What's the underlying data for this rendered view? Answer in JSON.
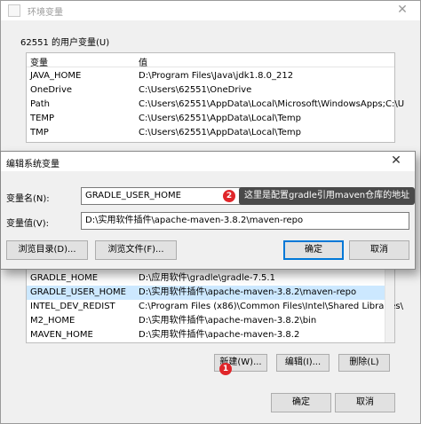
{
  "back_window": {
    "title": "环境变量",
    "close_glyph": "✕",
    "user_vars_label": "62551 的用户变量(U)",
    "user_vars": {
      "columns": [
        "变量",
        "值"
      ],
      "rows": [
        {
          "name": "JAVA_HOME",
          "value": "D:\\Program Files\\Java\\jdk1.8.0_212"
        },
        {
          "name": "OneDrive",
          "value": "C:\\Users\\62551\\OneDrive"
        },
        {
          "name": "Path",
          "value": "C:\\Users\\62551\\AppData\\Local\\Microsoft\\WindowsApps;C:\\U"
        },
        {
          "name": "TEMP",
          "value": "C:\\Users\\62551\\AppData\\Local\\Temp"
        },
        {
          "name": "TMP",
          "value": "C:\\Users\\62551\\AppData\\Local\\Temp"
        }
      ]
    },
    "system_vars": {
      "rows": [
        {
          "name": "GRADLE_HOME",
          "value": "D:\\应用软件\\gradle\\gradle-7.5.1"
        },
        {
          "name": "GRADLE_USER_HOME",
          "value": "D:\\实用软件插件\\apache-maven-3.8.2\\maven-repo"
        },
        {
          "name": "INTEL_DEV_REDIST",
          "value": "C:\\Program Files (x86)\\Common Files\\Intel\\Shared Libraries\\"
        },
        {
          "name": "M2_HOME",
          "value": "D:\\实用软件插件\\apache-maven-3.8.2\\bin"
        },
        {
          "name": "MAVEN_HOME",
          "value": "D:\\实用软件插件\\apache-maven-3.8.2"
        }
      ]
    },
    "buttons": {
      "new": "新建(W)...",
      "edit": "编辑(I)...",
      "delete": "删除(L)",
      "ok": "确定",
      "cancel": "取消"
    }
  },
  "dialog": {
    "title": "编辑系统变量",
    "close_glyph": "✕",
    "var_name_label": "变量名(N):",
    "var_name_value": "GRADLE_USER_HOME",
    "var_value_label": "变量值(V):",
    "var_value_value": "D:\\实用软件插件\\apache-maven-3.8.2\\maven-repo",
    "buttons": {
      "browse_dir": "浏览目录(D)...",
      "browse_file": "浏览文件(F)...",
      "ok": "确定",
      "cancel": "取消"
    }
  },
  "annotations": {
    "marker_1": "1",
    "marker_2": "2",
    "tooltip": "这里是配置gradle引用maven仓库的地址"
  },
  "colors": {
    "selection": "#cce8ff",
    "marker": "#e0262a",
    "primary_border": "#0078d7"
  }
}
